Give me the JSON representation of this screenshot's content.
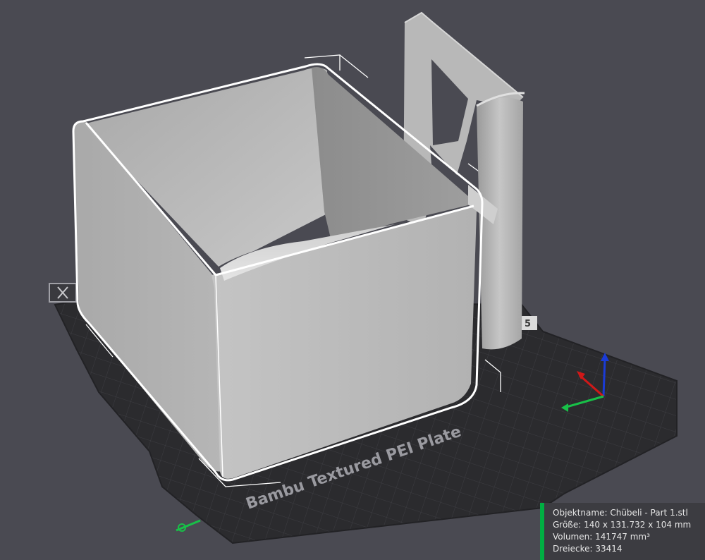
{
  "scene": {
    "plate_label": "Bambu Textured PEI Plate",
    "plate_id_badge": "5",
    "colors": {
      "background": "#4a4a52",
      "plate": "#2b2b2e",
      "grid": "#3f3f44",
      "model": "#bdbdbd",
      "selection": "#ffffff",
      "axis_x": "#d01818",
      "axis_y": "#18c048",
      "axis_z": "#1a3bd6",
      "accent": "#00ae42"
    },
    "icons": {
      "plate_close": "close-icon",
      "axes": "axes-gizmo-icon",
      "origin": "origin-marker-icon"
    }
  },
  "object_info": {
    "name_label": "Objektname:",
    "name_value": "Chübeli - Part 1.stl",
    "size_label": "Größe:",
    "size_value": "140 x 131.732 x 104 mm",
    "volume_label": "Volumen:",
    "volume_value": "141747 mm³",
    "triangles_label": "Dreiecke:",
    "triangles_value": "33414"
  }
}
